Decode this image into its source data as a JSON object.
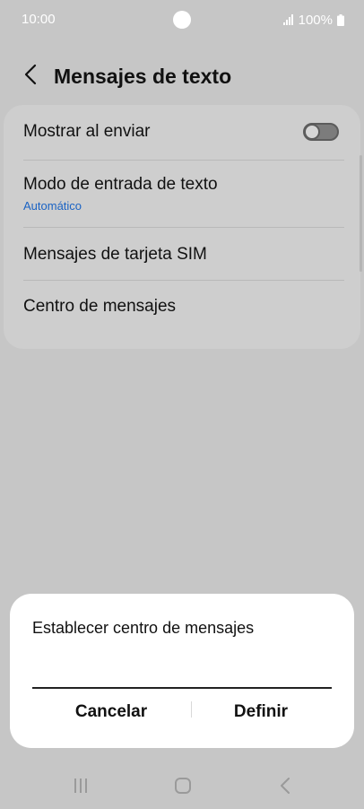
{
  "status_bar": {
    "time": "10:00",
    "battery": "100%"
  },
  "header": {
    "title": "Mensajes de texto"
  },
  "settings": {
    "items": [
      {
        "label": "Mostrar al enviar",
        "toggle_on": false
      },
      {
        "label": "Modo de entrada de texto",
        "sub": "Automático"
      },
      {
        "label": "Mensajes de tarjeta SIM"
      },
      {
        "label": "Centro de mensajes"
      }
    ]
  },
  "dialog": {
    "title": "Establecer centro de mensajes",
    "input_value": "",
    "cancel_label": "Cancelar",
    "set_label": "Definir"
  },
  "colors": {
    "scrim_background": "#c6c6c6",
    "dialog_background": "#ffffff",
    "accent_link": "#1a63c4"
  },
  "icons": {
    "back": "chevron-left-icon",
    "signal": "signal-icon",
    "battery": "battery-icon",
    "nav_recents": "recents-icon",
    "nav_home": "home-icon",
    "nav_back": "back-icon"
  }
}
